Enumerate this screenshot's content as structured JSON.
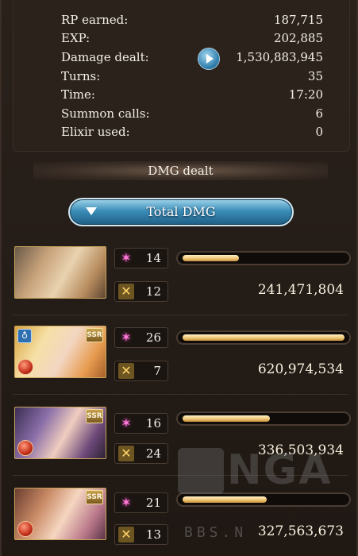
{
  "results": {
    "rows": [
      {
        "label": "RP earned:",
        "value": "187,715"
      },
      {
        "label": "EXP:",
        "value": "202,885"
      },
      {
        "label": "Damage dealt:",
        "value": "1,530,883,945"
      },
      {
        "label": "Turns:",
        "value": "35"
      },
      {
        "label": "Time:",
        "value": "17:20"
      },
      {
        "label": "Summon calls:",
        "value": "6"
      },
      {
        "label": "Elixir used:",
        "value": "0"
      }
    ]
  },
  "section_header": "DMG dealt",
  "filter_button": {
    "label": "Total DMG",
    "icon": "chevron-down-icon"
  },
  "characters": [
    {
      "skills": "14",
      "ougi": "12",
      "damage": "241,471,804",
      "bar_fraction": 0.35
    },
    {
      "skills": "26",
      "ougi": "7",
      "damage": "620,974,534",
      "bar_fraction": 1.0
    },
    {
      "skills": "16",
      "ougi": "24",
      "damage": "336,503,934",
      "bar_fraction": 0.54
    },
    {
      "skills": "21",
      "ougi": "13",
      "damage": "327,563,673",
      "bar_fraction": 0.52
    }
  ],
  "watermark": {
    "logo": "NGA",
    "text": "BBS.N"
  },
  "colors": {
    "bar": "#f2cb7c",
    "button": "#3b8db8",
    "element_fire": "#c4301a"
  }
}
